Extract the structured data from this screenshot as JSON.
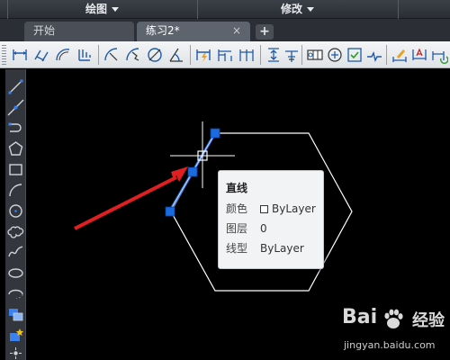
{
  "ribbon": {
    "panels": [
      {
        "label": "绘图"
      },
      {
        "label": "修改"
      }
    ]
  },
  "tabs": {
    "start_label": "开始",
    "active_label": "练习2*",
    "close_glyph": "×",
    "add_glyph": "+"
  },
  "tooltip": {
    "title": "直线",
    "rows": [
      {
        "label": "颜色",
        "value": "ByLayer"
      },
      {
        "label": "图层",
        "value": "0"
      },
      {
        "label": "线型",
        "value": "ByLayer"
      }
    ]
  },
  "watermark": {
    "brand_a": "Bai",
    "brand_b": "经验",
    "url": "jingyan.baidu.com"
  },
  "colors": {
    "canvas_bg": "#000000",
    "selected_line": "#2f6fe0",
    "grip": "#1a6be0",
    "hexagon": "#ffffff",
    "arrow": "#e02020",
    "crosshair": "#ffffff"
  },
  "icons": {
    "toolbar": [
      "linear-dimension-icon",
      "aligned-dimension-icon",
      "arc-length-dimension-icon",
      "ordinate-dimension-icon",
      "radius-dimension-icon",
      "jogged-dimension-icon",
      "diameter-dimension-icon",
      "angular-dimension-icon",
      "quick-dimension-icon",
      "baseline-dimension-icon",
      "continue-dimension-icon",
      "dimension-space-icon",
      "dimension-break-icon",
      "tolerance-icon",
      "center-mark-icon",
      "inspection-icon",
      "jogged-linear-icon",
      "dimension-edit-icon",
      "dimension-text-edit-icon",
      "dimension-update-icon"
    ],
    "left": [
      "line-icon",
      "construction-line-icon",
      "polyline-icon",
      "polygon-icon",
      "rectangle-icon",
      "arc-icon",
      "circle-icon",
      "revision-cloud-icon",
      "spline-icon",
      "ellipse-icon",
      "ellipse-arc-icon",
      "insert-block-icon",
      "make-block-icon",
      "point-icon"
    ]
  }
}
